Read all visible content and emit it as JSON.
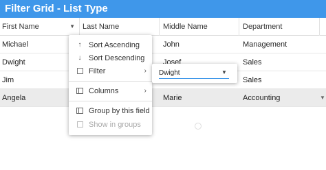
{
  "title": "Filter Grid - List Type",
  "columns": [
    {
      "label": "First Name"
    },
    {
      "label": "Last Name"
    },
    {
      "label": "Middle Name"
    },
    {
      "label": "Department"
    }
  ],
  "rows": [
    {
      "first": "Michael",
      "last": "",
      "middle": "John",
      "dept": "Management",
      "selected": false
    },
    {
      "first": "Dwight",
      "last": "",
      "middle": "Josef",
      "dept": "Sales",
      "selected": false
    },
    {
      "first": "Jim",
      "last": "",
      "middle": "",
      "dept": "Sales",
      "selected": false
    },
    {
      "first": "Angela",
      "last": "",
      "middle": "Marie",
      "dept": "Accounting",
      "selected": true
    }
  ],
  "column_menu": {
    "sort_ascending": "Sort Ascending",
    "sort_descending": "Sort Descending",
    "filter": "Filter",
    "columns": "Columns",
    "group_by_field": "Group by this field",
    "show_in_groups": "Show in groups"
  },
  "filter_submenu": {
    "value": "Dwight"
  },
  "colors": {
    "title_bar": "#3f97ea",
    "selected_row": "#ebebeb",
    "input_underline": "#3f97ea"
  }
}
